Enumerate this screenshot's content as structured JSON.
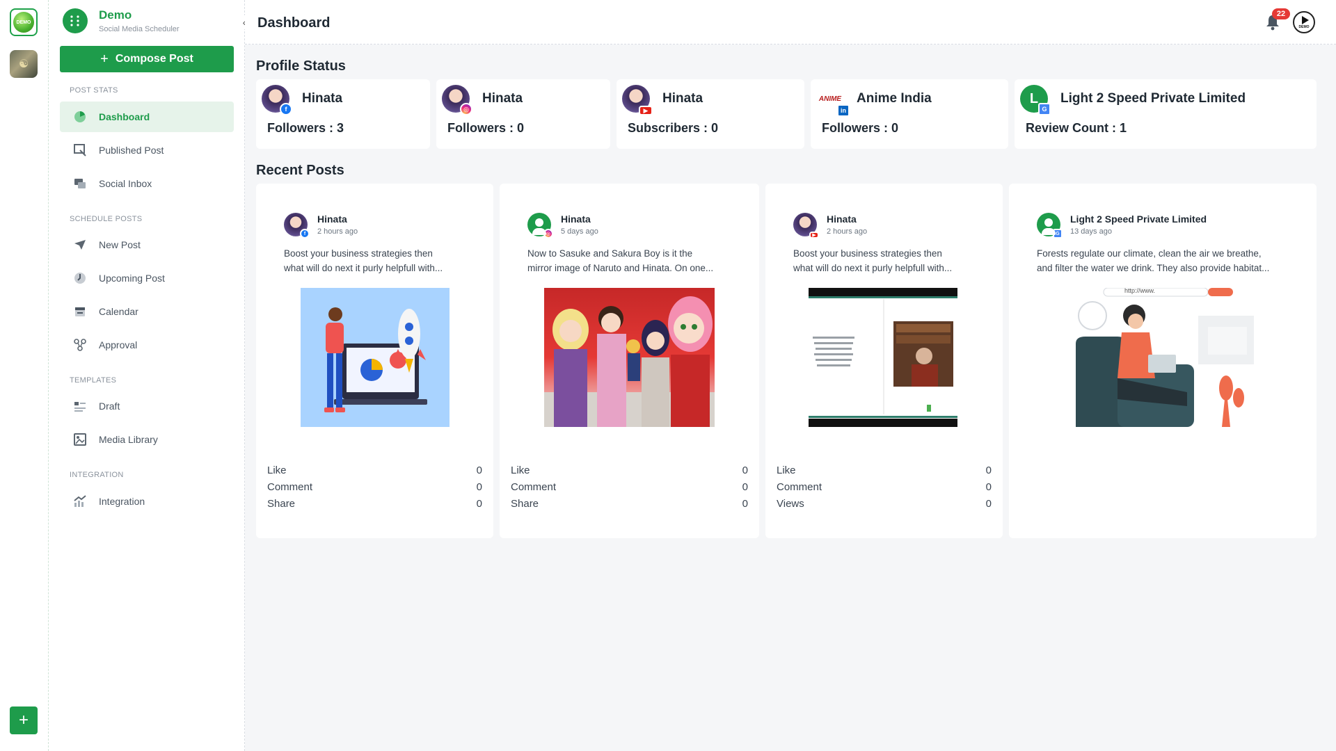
{
  "workspace": {
    "add_label": "+",
    "ws1_label": "DEMO"
  },
  "brand": {
    "name": "Demo",
    "subtitle": "Social Media Scheduler",
    "collapse_glyph": "‹"
  },
  "compose": {
    "plus": "+",
    "label": "Compose Post"
  },
  "sections": {
    "post_stats": "POST STATS",
    "schedule_posts": "SCHEDULE POSTS",
    "templates": "TEMPLATES",
    "integration": "INTEGRATION"
  },
  "nav": {
    "dashboard": "Dashboard",
    "published": "Published Post",
    "inbox": "Social Inbox",
    "new_post": "New Post",
    "upcoming": "Upcoming Post",
    "calendar": "Calendar",
    "approval": "Approval",
    "draft": "Draft",
    "media": "Media Library",
    "integration": "Integration"
  },
  "header": {
    "title": "Dashboard",
    "notification_count": "22",
    "demo_label": "DEMO"
  },
  "profile_status": {
    "title": "Profile Status",
    "cards": [
      {
        "name": "Hinata",
        "stat": "Followers : 3",
        "network": "f"
      },
      {
        "name": "Hinata",
        "stat": "Followers : 0",
        "network": "◎"
      },
      {
        "name": "Hinata",
        "stat": "Subscribers : 0",
        "network": "▶"
      },
      {
        "name": "Anime India",
        "stat": "Followers : 0",
        "network": "in",
        "logo": "ANIME"
      },
      {
        "name": "Light 2 Speed Private Limited",
        "stat": "Review Count : 1",
        "network": "G",
        "initial": "L"
      }
    ]
  },
  "recent_posts": {
    "title": "Recent Posts",
    "posts": [
      {
        "author": "Hinata",
        "time": "2 hours ago",
        "text_line1": "Boost your business strategies then",
        "text_line2": "what will do next it purly helpfull with...",
        "stats": [
          {
            "label": "Like",
            "value": "0"
          },
          {
            "label": "Comment",
            "value": "0"
          },
          {
            "label": "Share",
            "value": "0"
          }
        ]
      },
      {
        "author": "Hinata",
        "time": "5 days ago",
        "text_line1": "Now to Sasuke and Sakura Boy is it the",
        "text_line2": "mirror image of Naruto and Hinata. On one...",
        "stats": [
          {
            "label": "Like",
            "value": "0"
          },
          {
            "label": "Comment",
            "value": "0"
          },
          {
            "label": "Share",
            "value": "0"
          }
        ]
      },
      {
        "author": "Hinata",
        "time": "2 hours ago",
        "text_line1": "Boost your business strategies then",
        "text_line2": "what will do next it purly helpfull with...",
        "stats": [
          {
            "label": "Like",
            "value": "0"
          },
          {
            "label": "Comment",
            "value": "0"
          },
          {
            "label": "Views",
            "value": "0"
          }
        ]
      },
      {
        "author": "Light 2 Speed Private Limited",
        "time": "13 days ago",
        "text_line1": "Forests regulate our climate, clean the air we breathe,",
        "text_line2": "and filter the water we drink. They also provide habitat...",
        "url_text": "http://www."
      }
    ]
  },
  "colors": {
    "accent": "#1e9c4b",
    "badge": "#e53935"
  }
}
